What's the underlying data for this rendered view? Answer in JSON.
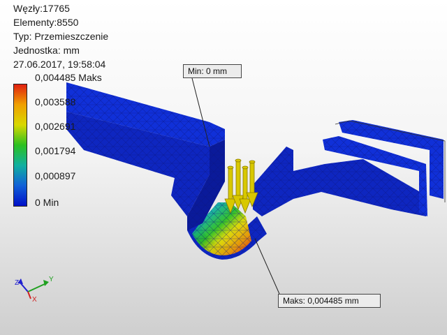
{
  "info": {
    "nodes": "Węzły:17765",
    "elements": "Elementy:8550",
    "type": "Typ: Przemieszczenie",
    "unit": "Jednostka: mm",
    "timestamp": "27.06.2017, 19:58:04"
  },
  "legend": {
    "labels": [
      "0,004485 Maks",
      "0,003588",
      "0,002691",
      "0,001794",
      "0,000897",
      "0 Min"
    ],
    "colors": [
      "#e02010",
      "#f0a000",
      "#d8d800",
      "#2cc020",
      "#10b0a0",
      "#1060d8",
      "#0010c8"
    ]
  },
  "callouts": {
    "min": "Min: 0 mm",
    "max": "Maks: 0,004485 mm"
  },
  "axes": {
    "x": "X",
    "y": "Y",
    "z": "Z"
  },
  "colors": {
    "mesh_blue": "#1030d8",
    "mesh_dark": "#0a1a9a",
    "arrow_yellow": "#d8c800"
  }
}
